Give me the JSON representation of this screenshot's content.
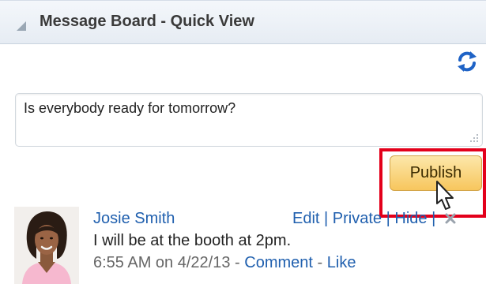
{
  "panel": {
    "title": "Message Board - Quick View"
  },
  "icons": {
    "collapse": "collapse-triangle-icon",
    "refresh": "refresh-icon",
    "resize": "resize-grip-icon",
    "delete": "delete-x-icon",
    "cursor": "mouse-pointer-icon"
  },
  "composer": {
    "value": "Is everybody ready for tomorrow?",
    "publish_label": "Publish"
  },
  "colors": {
    "link": "#1f5fae",
    "publish_bg": "#f7c65d",
    "highlight": "#e3001b",
    "refresh": "#1f63c6"
  },
  "posts": [
    {
      "author": "Josie Smith",
      "actions": {
        "edit": "Edit",
        "private": "Private",
        "hide": "Hide",
        "separator": "|"
      },
      "message": "I will be at the booth at 2pm.",
      "timestamp": "6:55 AM on 4/22/13",
      "dash": "-",
      "comment": "Comment",
      "like": "Like"
    }
  ]
}
